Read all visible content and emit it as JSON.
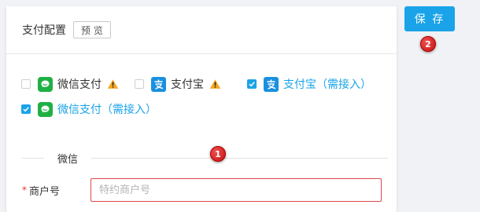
{
  "header": {
    "title": "支付配置",
    "preview_label": "预 览"
  },
  "payment_options": [
    {
      "label": "微信支付",
      "checked": false,
      "icon": "wechat-pay-icon",
      "warning": true
    },
    {
      "label": "支付宝",
      "checked": false,
      "icon": "alipay-icon",
      "warning": true
    },
    {
      "label": "支付宝（需接入）",
      "checked": true,
      "icon": "alipay-icon",
      "warning": false
    },
    {
      "label": "微信支付（需接入）",
      "checked": true,
      "icon": "wechat-pay-icon",
      "warning": false
    }
  ],
  "section": {
    "label": "微信"
  },
  "merchant_field": {
    "required_mark": "*",
    "label": "商户号",
    "value": "",
    "placeholder": "特约商户号"
  },
  "save_label": "保 存",
  "badges": {
    "b1": "1",
    "b2": "2"
  },
  "colors": {
    "accent": "#1aa3e8",
    "error_border": "#e0474c",
    "wechat_green": "#1fb044",
    "alipay_blue": "#1a8fe0",
    "warning": "#f5a623",
    "badge_red": "#d42020"
  }
}
